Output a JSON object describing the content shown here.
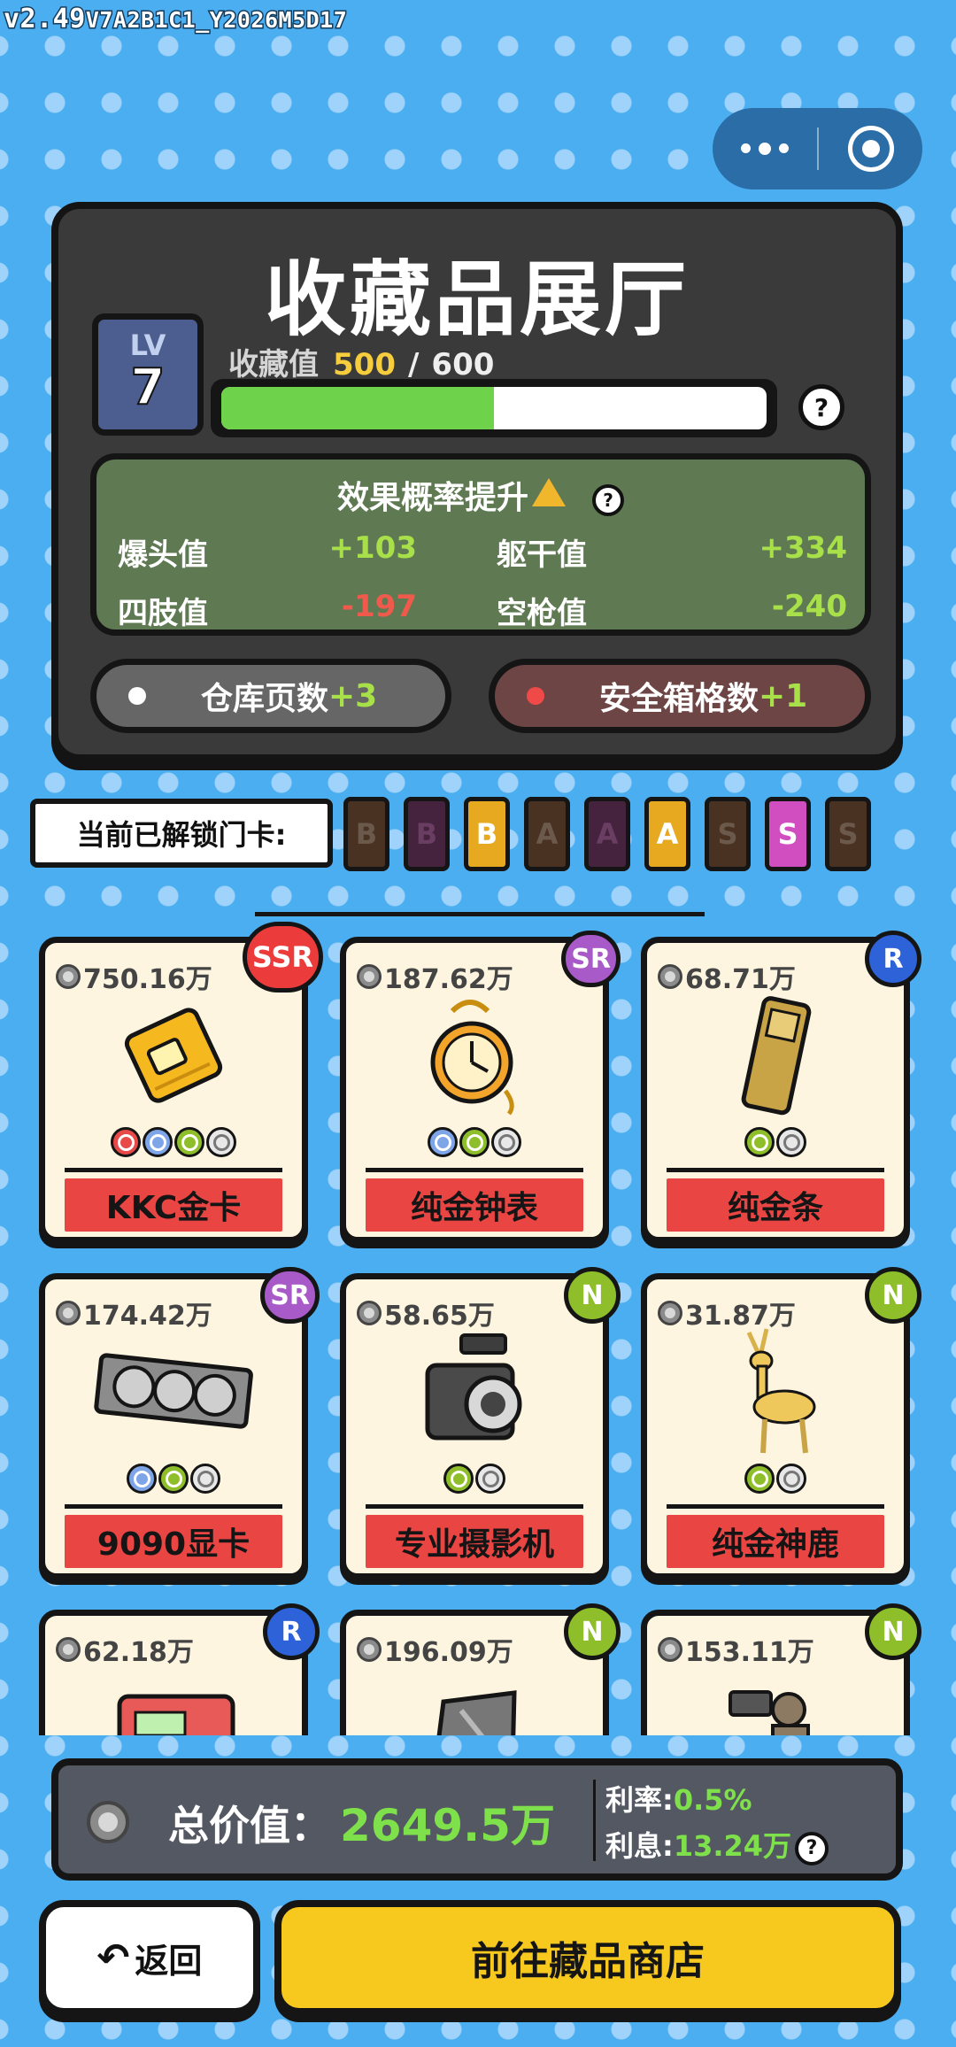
{
  "version": {
    "main": "v2.49",
    "build": "V7A2B1C1_Y2026M5D17"
  },
  "title": "收藏品展厅",
  "level": {
    "label": "LV",
    "value": "7"
  },
  "collection": {
    "label": "收藏值",
    "current": "500",
    "sep": "/",
    "max": "600",
    "progress": 0.5
  },
  "effect": {
    "title": "效果概率提升",
    "stats": [
      {
        "label": "爆头值",
        "value": "+103",
        "sign": "pos"
      },
      {
        "label": "躯干值",
        "value": "+334",
        "sign": "pos"
      },
      {
        "label": "四肢值",
        "value": "-197",
        "sign": "neg"
      },
      {
        "label": "空枪值",
        "value": "-240",
        "sign": "pos"
      }
    ]
  },
  "bonuses": {
    "storage": {
      "label": "仓库页数",
      "plus": "+3"
    },
    "safe": {
      "label": "安全箱格数",
      "plus": "+1"
    }
  },
  "unlock": {
    "label": "当前已解锁门卡:",
    "cards": [
      {
        "letter": "B",
        "bg": "#4a3222",
        "fg": "#6b5a4c"
      },
      {
        "letter": "B",
        "bg": "#45233e",
        "fg": "#6a3d62"
      },
      {
        "letter": "B",
        "bg": "#e6a920",
        "fg": "#ffffff"
      },
      {
        "letter": "A",
        "bg": "#4a3222",
        "fg": "#6b5a4c"
      },
      {
        "letter": "A",
        "bg": "#45233e",
        "fg": "#6a3d62"
      },
      {
        "letter": "A",
        "bg": "#e6a920",
        "fg": "#ffffff"
      },
      {
        "letter": "S",
        "bg": "#4a3222",
        "fg": "#6b5a4c"
      },
      {
        "letter": "S",
        "bg": "#d04ec0",
        "fg": "#ffffff"
      },
      {
        "letter": "S",
        "bg": "#4a3222",
        "fg": "#6b5a4c"
      }
    ]
  },
  "items": [
    {
      "value": "750.16万",
      "rarity": "SSR",
      "name": "KKC金卡",
      "icon": "gold-card",
      "gems": [
        "red",
        "blue",
        "green",
        "white"
      ]
    },
    {
      "value": "187.62万",
      "rarity": "SR",
      "name": "纯金钟表",
      "icon": "gold-pocket-watch",
      "gems": [
        "blue",
        "green",
        "white"
      ]
    },
    {
      "value": "68.71万",
      "rarity": "R",
      "name": "纯金条",
      "icon": "gold-bar",
      "gems": [
        "green",
        "white"
      ]
    },
    {
      "value": "174.42万",
      "rarity": "SR",
      "name": "9090显卡",
      "icon": "graphics-card",
      "gems": [
        "blue",
        "green",
        "white"
      ]
    },
    {
      "value": "58.65万",
      "rarity": "N",
      "name": "专业摄影机",
      "icon": "video-camera",
      "gems": [
        "green",
        "white"
      ]
    },
    {
      "value": "31.87万",
      "rarity": "N",
      "name": "纯金神鹿",
      "icon": "gold-deer",
      "gems": [
        "green",
        "white"
      ]
    },
    {
      "value": "62.18万",
      "rarity": "R",
      "name": "",
      "icon": "red-device",
      "gems": []
    },
    {
      "value": "196.09万",
      "rarity": "N",
      "name": "",
      "icon": "laptop",
      "gems": []
    },
    {
      "value": "153.11万",
      "rarity": "N",
      "name": "",
      "icon": "camera-statue",
      "gems": []
    }
  ],
  "total": {
    "label": "总价值：",
    "value": "2649.5万"
  },
  "rate": {
    "label": "利率:",
    "value": "0.5%"
  },
  "interest": {
    "label": "利息:",
    "value": "13.24万"
  },
  "buttons": {
    "back": "返回",
    "shop": "前往藏品商店"
  }
}
